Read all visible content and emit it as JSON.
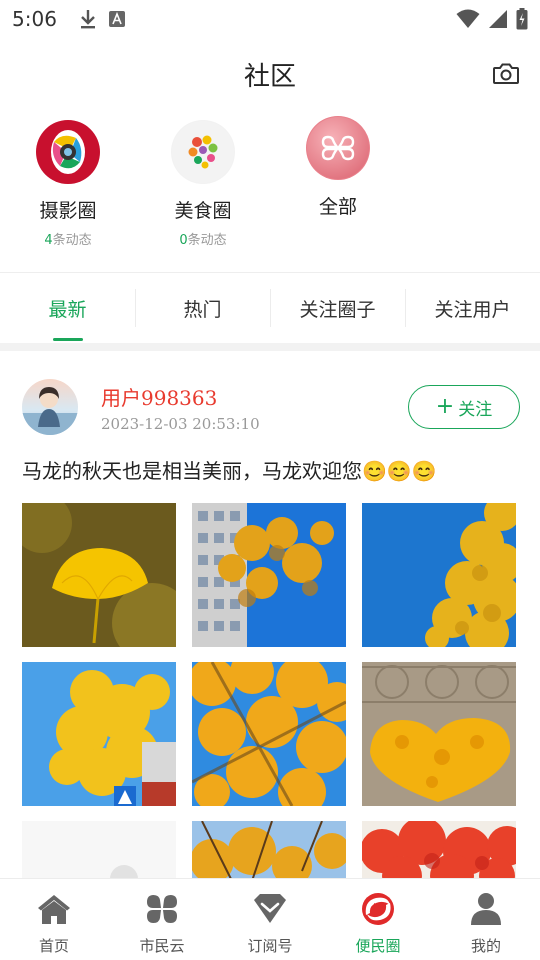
{
  "status_bar": {
    "time": "5:06",
    "icons": [
      "download-icon",
      "a-icon",
      "wifi-icon",
      "signal-icon",
      "battery-icon"
    ]
  },
  "header": {
    "title": "社区",
    "camera_icon": "camera-icon"
  },
  "circles": [
    {
      "name": "摄影圈",
      "count": "4",
      "count_suffix": "条动态"
    },
    {
      "name": "美食圈",
      "count": "0",
      "count_suffix": "条动态"
    },
    {
      "name": "全部"
    }
  ],
  "tabs": [
    {
      "label": "最新",
      "active": true
    },
    {
      "label": "热门"
    },
    {
      "label": "关注圈子"
    },
    {
      "label": "关注用户"
    }
  ],
  "post": {
    "username": "用户998363",
    "timestamp": "2023-12-03 20:53:10",
    "follow_label": "关注",
    "text": "马龙的秋天也是相当美丽，马龙欢迎您😊😊😊"
  },
  "bottom_nav": [
    {
      "label": "首页",
      "icon": "home-icon"
    },
    {
      "label": "市民云",
      "icon": "cloud-clover-icon"
    },
    {
      "label": "订阅号",
      "icon": "subscription-icon"
    },
    {
      "label": "便民圈",
      "icon": "circle-logo-icon",
      "active": true
    },
    {
      "label": "我的",
      "icon": "person-icon"
    }
  ],
  "colors": {
    "accent": "#1aa65a",
    "username": "#e83a2e",
    "muted": "#999999"
  }
}
